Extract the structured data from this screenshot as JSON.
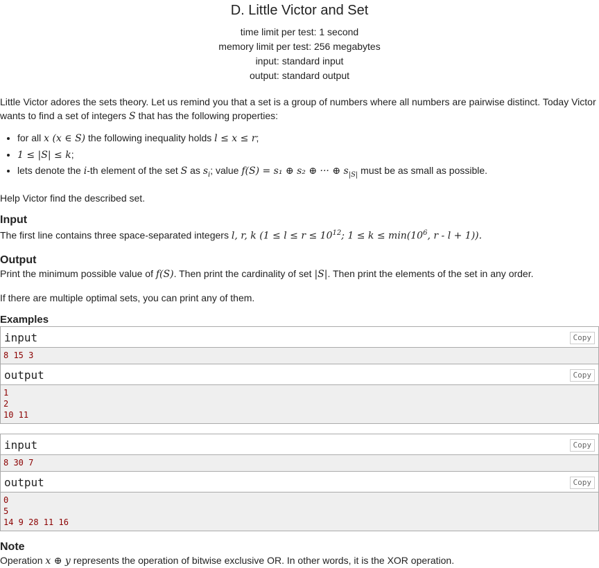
{
  "header": {
    "title": "D. Little Victor and Set",
    "time_limit": "time limit per test: 1 second",
    "memory_limit": "memory limit per test: 256 megabytes",
    "input": "input: standard input",
    "output": "output: standard output"
  },
  "legend": {
    "p1": "Little Victor adores the sets theory. Let us remind you that a set is a group of numbers where all numbers are pairwise distinct. Today Victor wants to find a set of integers ",
    "p1_var": "S",
    "p1_end": " that has the following properties:",
    "li1_a": "for all ",
    "li1_m": "x (x ∈ S)",
    "li1_b": " the following inequality holds ",
    "li1_m2": "l ≤ x ≤ r",
    "li1_end": ";",
    "li2_m": "1 ≤ |S| ≤ k",
    "li2_end": ";",
    "li3_a": "lets denote the ",
    "li3_m": "i",
    "li3_b": "-th element of the set ",
    "li3_m2": "S",
    "li3_c": " as ",
    "li3_m3": "s",
    "li3_sub": "i",
    "li3_d": "; value ",
    "li3_m4": "f(S) = s₁ ⊕ s₂ ⊕ ··· ⊕ s",
    "li3_sub2": "|S|",
    "li3_end": " must be as small as possible.",
    "help": "Help Victor find the described set."
  },
  "input_spec": {
    "title": "Input",
    "text": "The first line contains three space-separated integers ",
    "m1": "l, r, k (1 ≤ l ≤ r ≤ 10",
    "sup1": "12",
    "m2": "; 1 ≤ k ≤ min(10",
    "sup2": "6",
    "m3": ", r - l + 1)).",
    "end": ""
  },
  "output_spec": {
    "title": "Output",
    "a": "Print the minimum possible value of ",
    "m1": "f(S)",
    "b": ". Then print the cardinality of set ",
    "m2": "|S|",
    "c": ". Then print the elements of the set in any order.",
    "p2": "If there are multiple optimal sets, you can print any of them."
  },
  "examples": {
    "title": "Examples",
    "input_label": "input",
    "output_label": "output",
    "copy_label": "Copy",
    "tests": [
      {
        "input": "8 15 3",
        "output": "1\n2\n10 11"
      },
      {
        "input": "8 30 7",
        "output": "0\n5\n14 9 28 11 16"
      }
    ]
  },
  "note": {
    "title": "Note",
    "a": "Operation ",
    "m": "x ⊕ y",
    "b": " represents the operation of bitwise exclusive OR. In other words, it is the XOR operation."
  }
}
